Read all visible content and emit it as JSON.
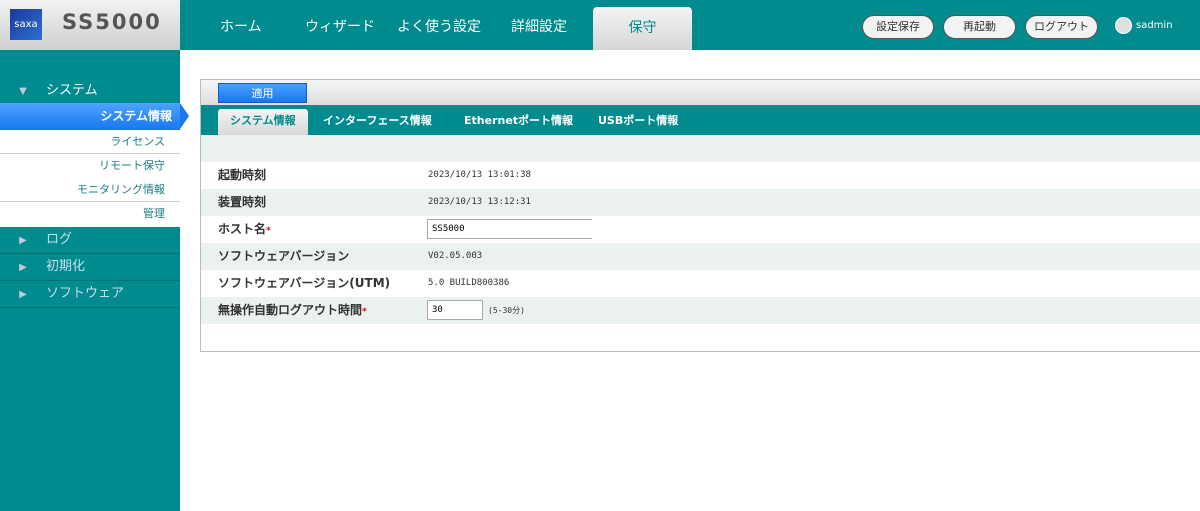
{
  "header": {
    "logo_text": "saxa",
    "product": "SS5000",
    "nav": [
      "ホーム",
      "ウィザード",
      "よく使う設定",
      "詳細設定",
      "保守"
    ],
    "buttons": [
      "設定保存",
      "再起動",
      "ログアウト"
    ],
    "user": "sadmin"
  },
  "sidebar": {
    "section": "システム",
    "selected": "システム情報",
    "subitems": [
      "ライセンス",
      "リモート保守",
      "モニタリング情報",
      "管理"
    ],
    "groups": [
      "ログ",
      "初期化",
      "ソフトウェア"
    ]
  },
  "toolbar": {
    "apply": "適用"
  },
  "tabs": [
    "システム情報",
    "インターフェース情報",
    "Ethernetポート情報",
    "USBポート情報"
  ],
  "rows": {
    "boot_label": "起動時刻",
    "boot": "2023/10/13 13:01:38",
    "clock_label": "装置時刻",
    "clock": "2023/10/13 13:12:31",
    "host_label": "ホスト名",
    "host": "SS5000",
    "ver_label": "ソフトウェアバージョン",
    "ver": "V02.05.003",
    "utm_label": "ソフトウェアバージョン(UTM)",
    "utm": "5.0 BUILD800386",
    "logout_label": "無操作自動ログアウト時間",
    "logout": "30",
    "logout_hint": "(5-30分)",
    "required_mark": "*"
  }
}
